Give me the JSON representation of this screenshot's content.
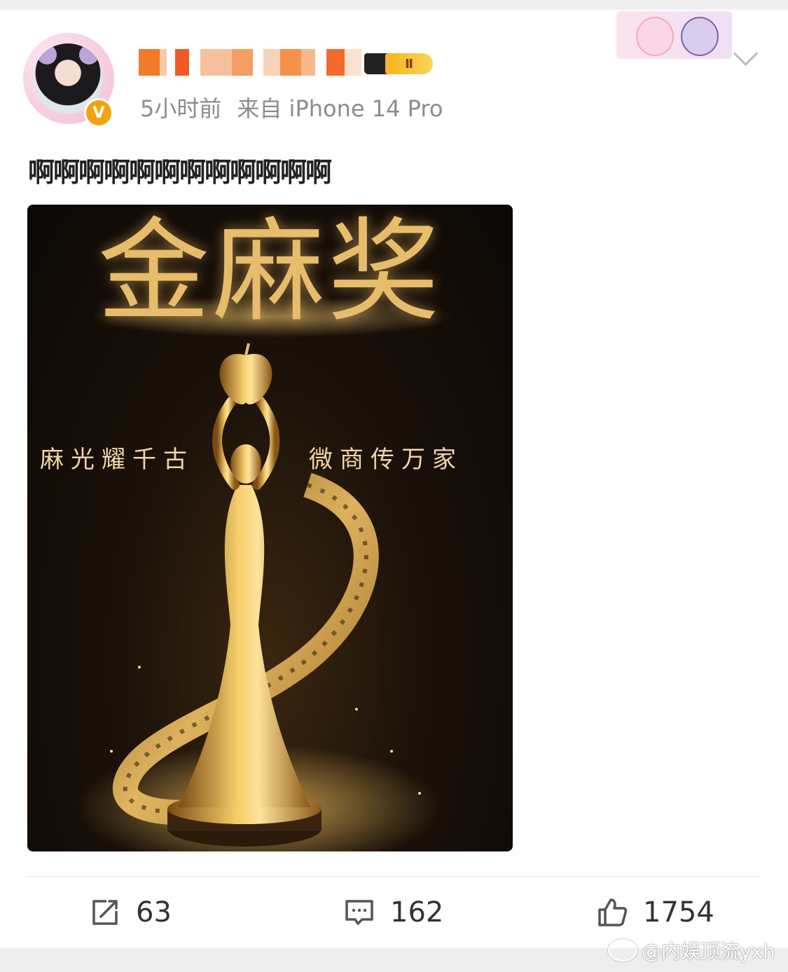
{
  "header": {
    "verified_badge_label": "V",
    "member_level": "Ⅱ",
    "time": "5小时前",
    "source": "来自 iPhone 14 Pro"
  },
  "post": {
    "text": "啊啊啊啊啊啊啊啊啊啊啊啊",
    "image": {
      "title": "金麻奖",
      "left_slogan": "麻光耀千古",
      "right_slogan": "微商传万家"
    }
  },
  "actions": {
    "repost_count": "63",
    "comment_count": "162",
    "like_count": "1754"
  },
  "watermark": {
    "text": "@内娱顶流yxh"
  },
  "icons": {
    "repost": "repost-icon",
    "comment": "comment-icon",
    "like": "thumbs-up-icon",
    "more": "chevron-down-icon"
  },
  "colors": {
    "meta_text": "#8c8c8c",
    "verified_badge": "#f2a311",
    "gold": "#e7bd6c"
  }
}
